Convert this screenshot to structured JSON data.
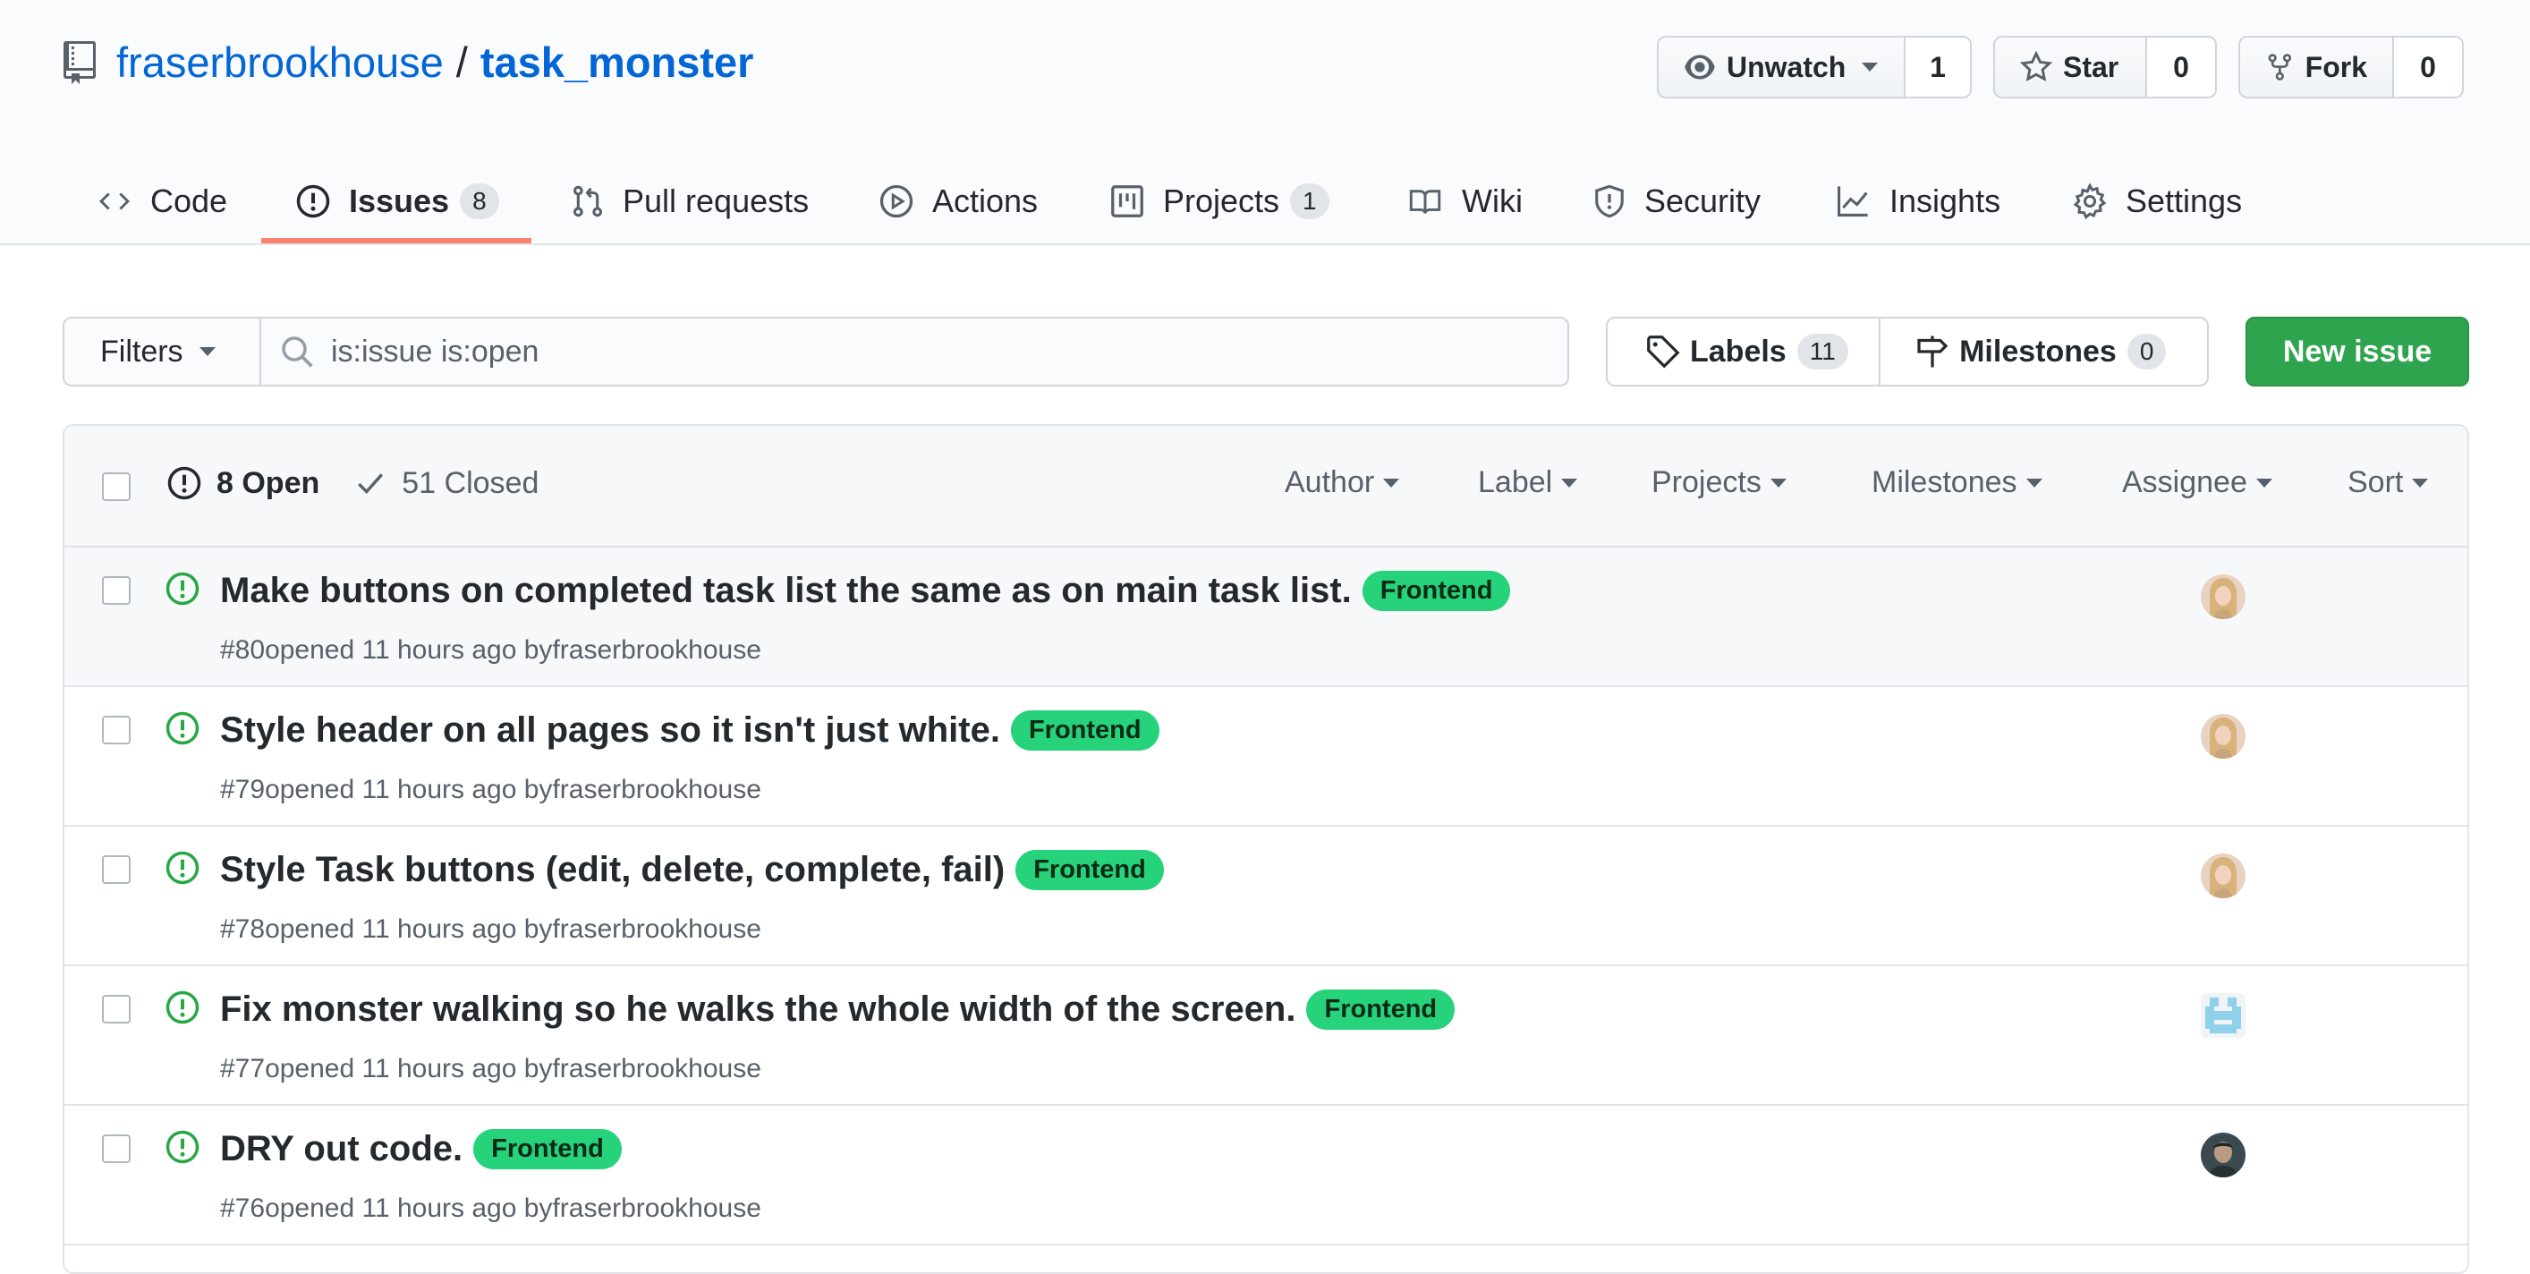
{
  "repo": {
    "owner": "fraserbrookhouse",
    "separator": "/",
    "name": "task_monster"
  },
  "repo_actions": {
    "watch": {
      "label": "Unwatch",
      "count": "1"
    },
    "star": {
      "label": "Star",
      "count": "0"
    },
    "fork": {
      "label": "Fork",
      "count": "0"
    }
  },
  "tabs": [
    {
      "label": "Code"
    },
    {
      "label": "Issues",
      "count": "8"
    },
    {
      "label": "Pull requests"
    },
    {
      "label": "Actions"
    },
    {
      "label": "Projects",
      "count": "1"
    },
    {
      "label": "Wiki"
    },
    {
      "label": "Security"
    },
    {
      "label": "Insights"
    },
    {
      "label": "Settings"
    }
  ],
  "subnav": {
    "filters_label": "Filters",
    "search_value": "is:issue is:open",
    "labels": {
      "label": "Labels",
      "count": "11"
    },
    "milestones": {
      "label": "Milestones",
      "count": "0"
    },
    "new_issue_label": "New issue"
  },
  "issues_header": {
    "open_label": "8 Open",
    "closed_label": "51 Closed",
    "menus": [
      "Author",
      "Label",
      "Projects",
      "Milestones",
      "Assignee",
      "Sort"
    ]
  },
  "issues": [
    {
      "title": "Make buttons on completed task list the same as on main task list.",
      "label": "Frontend",
      "number": "#80",
      "opened": "opened 11 hours ago by",
      "author": "fraserbrookhouse",
      "assignee_avatar": "avatar-photo-woman"
    },
    {
      "title": "Style header on all pages so it isn't just white.",
      "label": "Frontend",
      "number": "#79",
      "opened": "opened 11 hours ago by",
      "author": "fraserbrookhouse",
      "assignee_avatar": "avatar-photo-woman"
    },
    {
      "title": "Style Task buttons (edit, delete, complete, fail)",
      "label": "Frontend",
      "number": "#78",
      "opened": "opened 11 hours ago by",
      "author": "fraserbrookhouse",
      "assignee_avatar": "avatar-photo-woman"
    },
    {
      "title": "Fix monster walking so he walks the whole width of the screen.",
      "label": "Frontend",
      "number": "#77",
      "opened": "opened 11 hours ago by",
      "author": "fraserbrookhouse",
      "assignee_avatar": "avatar-identicon"
    },
    {
      "title": "DRY out code.",
      "label": "Frontend",
      "number": "#76",
      "opened": "opened 11 hours ago by",
      "author": "fraserbrookhouse",
      "assignee_avatar": "avatar-photo-man"
    }
  ],
  "colors": {
    "link": "#0366d6",
    "open_icon": "#28a745",
    "label_bg": "#26d27a",
    "new_issue_bg": "#2ea44f",
    "selected_tab_underline": "#f9826c"
  }
}
